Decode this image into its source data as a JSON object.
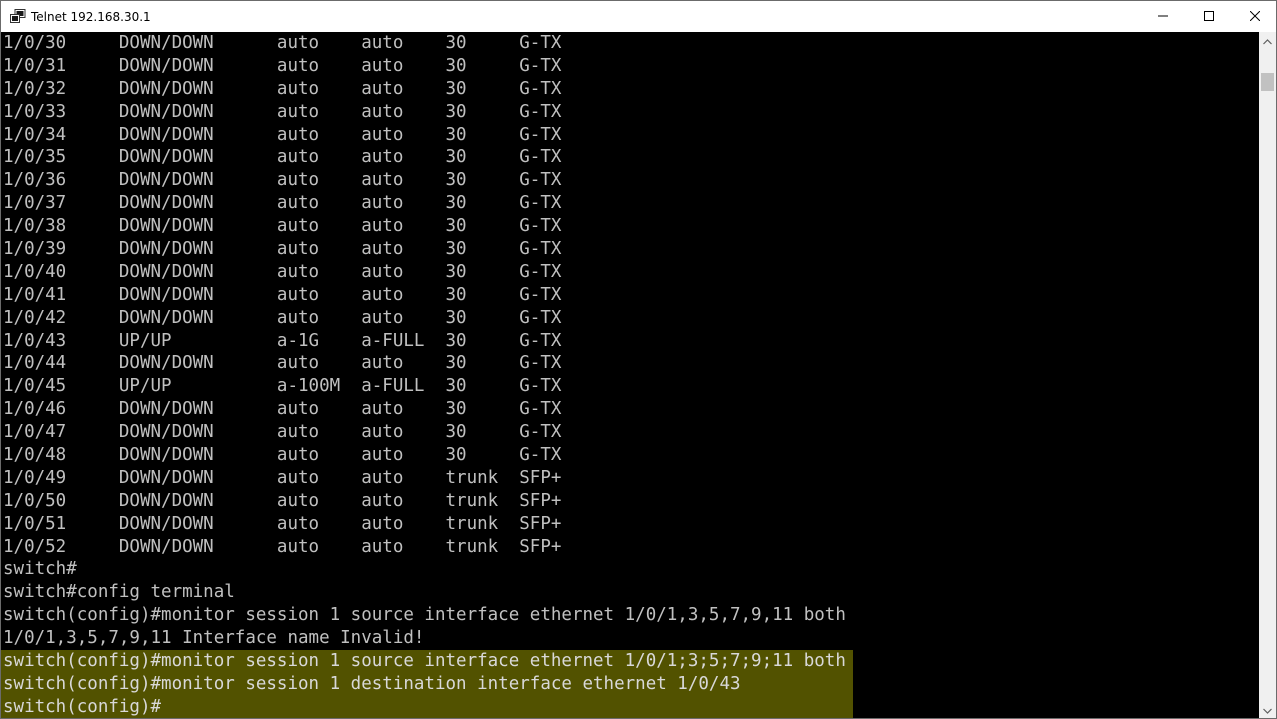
{
  "window": {
    "title": "Telnet 192.168.30.1",
    "icon": "telnet-console-icon",
    "controls": [
      "minimize-icon",
      "maximize-icon",
      "close-icon"
    ]
  },
  "terminal": {
    "colors": {
      "background": "#000000",
      "text": "#c0c0c0",
      "highlight": "#525200"
    },
    "lines": [
      "1/0/30     DOWN/DOWN      auto    auto    30     G-TX",
      "1/0/31     DOWN/DOWN      auto    auto    30     G-TX",
      "1/0/32     DOWN/DOWN      auto    auto    30     G-TX",
      "1/0/33     DOWN/DOWN      auto    auto    30     G-TX",
      "1/0/34     DOWN/DOWN      auto    auto    30     G-TX",
      "1/0/35     DOWN/DOWN      auto    auto    30     G-TX",
      "1/0/36     DOWN/DOWN      auto    auto    30     G-TX",
      "1/0/37     DOWN/DOWN      auto    auto    30     G-TX",
      "1/0/38     DOWN/DOWN      auto    auto    30     G-TX",
      "1/0/39     DOWN/DOWN      auto    auto    30     G-TX",
      "1/0/40     DOWN/DOWN      auto    auto    30     G-TX",
      "1/0/41     DOWN/DOWN      auto    auto    30     G-TX",
      "1/0/42     DOWN/DOWN      auto    auto    30     G-TX",
      "1/0/43     UP/UP          a-1G    a-FULL  30     G-TX",
      "1/0/44     DOWN/DOWN      auto    auto    30     G-TX",
      "1/0/45     UP/UP          a-100M  a-FULL  30     G-TX",
      "1/0/46     DOWN/DOWN      auto    auto    30     G-TX",
      "1/0/47     DOWN/DOWN      auto    auto    30     G-TX",
      "1/0/48     DOWN/DOWN      auto    auto    30     G-TX",
      "1/0/49     DOWN/DOWN      auto    auto    trunk  SFP+",
      "1/0/50     DOWN/DOWN      auto    auto    trunk  SFP+",
      "1/0/51     DOWN/DOWN      auto    auto    trunk  SFP+",
      "1/0/52     DOWN/DOWN      auto    auto    trunk  SFP+",
      "switch#",
      "switch#config terminal",
      "switch(config)#monitor session 1 source interface ethernet 1/0/1,3,5,7,9,11 both",
      "1/0/1,3,5,7,9,11 Interface name Invalid!",
      "switch(config)#monitor session 1 source interface ethernet 1/0/1;3;5;7;9;11 both",
      "switch(config)#monitor session 1 destination interface ethernet 1/0/43",
      "switch(config)#"
    ],
    "highlighted_line_indices": [
      27,
      28,
      29
    ]
  },
  "scrollbar": {
    "up_icon": "scroll-up-arrow-icon",
    "down_icon": "scroll-down-arrow-icon"
  }
}
